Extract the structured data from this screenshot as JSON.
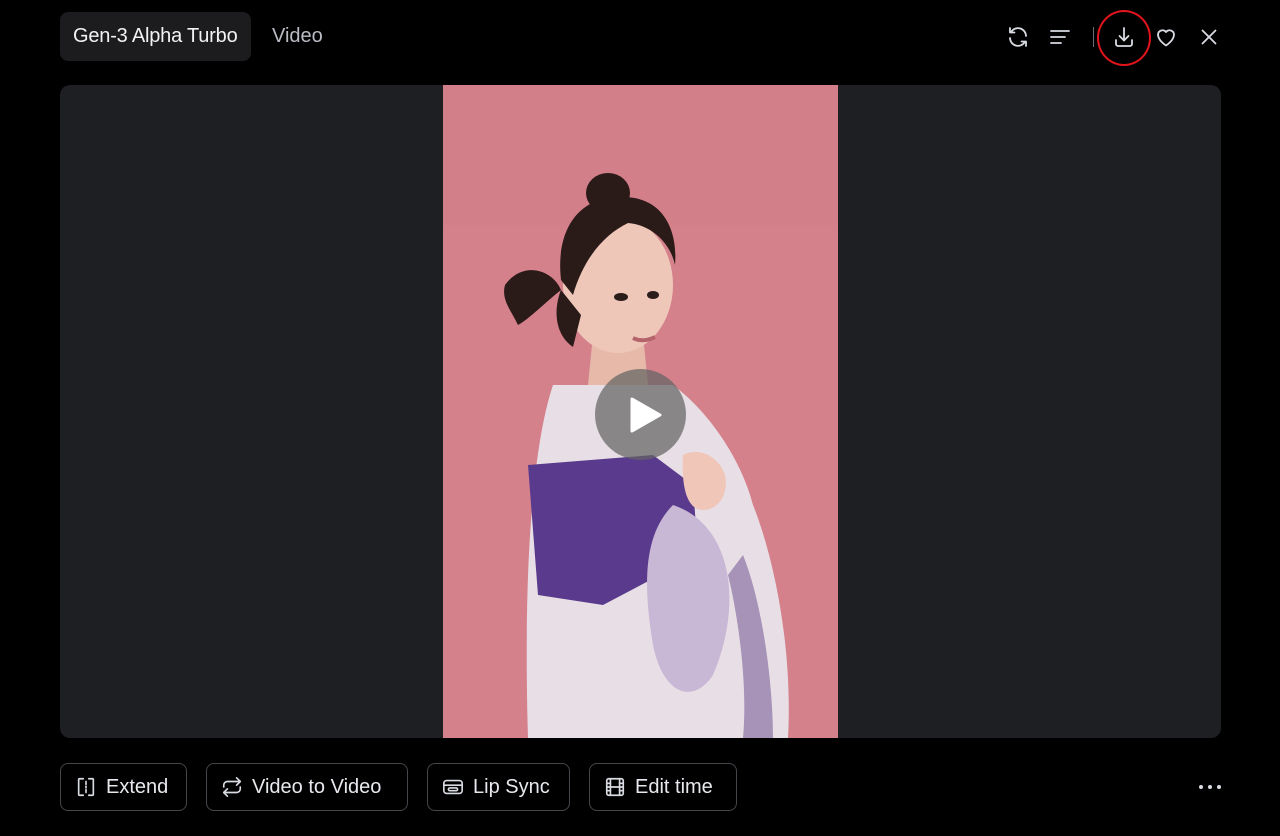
{
  "header": {
    "model_label": "Gen-3 Alpha Turbo",
    "type_label": "Video",
    "actions": [
      {
        "name": "regenerate-icon"
      },
      {
        "name": "details-icon"
      },
      {
        "name": "download-icon",
        "highlighted": true
      },
      {
        "name": "heart-icon"
      },
      {
        "name": "close-icon"
      }
    ]
  },
  "player": {
    "state": "paused",
    "play_icon": "play-icon"
  },
  "toolbar": {
    "buttons": [
      {
        "icon": "extend-icon",
        "label": "Extend"
      },
      {
        "icon": "loop-arrows-icon",
        "label": "Video to Video"
      },
      {
        "icon": "lip-sync-icon",
        "label": "Lip Sync"
      },
      {
        "icon": "film-strip-icon",
        "label": "Edit time"
      }
    ],
    "more_icon": "more-horizontal-icon"
  },
  "colors": {
    "background": "#000000",
    "player_bg": "#1e1f22",
    "video_backdrop": "#d4818c",
    "highlight": "#e3141c"
  }
}
